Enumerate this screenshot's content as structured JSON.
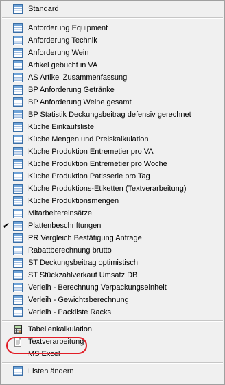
{
  "menu": {
    "top": [
      {
        "label": "Standard",
        "icon": "table-icon",
        "checked": false
      }
    ],
    "lists": [
      {
        "label": "Anforderung Equipment",
        "icon": "table-icon",
        "checked": false
      },
      {
        "label": "Anforderung Technik",
        "icon": "table-icon",
        "checked": false
      },
      {
        "label": "Anforderung Wein",
        "icon": "table-icon",
        "checked": false
      },
      {
        "label": "Artikel gebucht in VA",
        "icon": "table-icon",
        "checked": false
      },
      {
        "label": "AS Artikel Zusammenfassung",
        "icon": "table-icon",
        "checked": false
      },
      {
        "label": "BP Anforderung Getränke",
        "icon": "table-icon",
        "checked": false
      },
      {
        "label": "BP Anforderung Weine gesamt",
        "icon": "table-icon",
        "checked": false
      },
      {
        "label": "BP Statistik Deckungsbeitrag defensiv gerechnet",
        "icon": "table-icon",
        "checked": false
      },
      {
        "label": "Küche Einkaufsliste",
        "icon": "table-icon",
        "checked": false
      },
      {
        "label": "Küche Mengen und Preiskalkulation",
        "icon": "table-icon",
        "checked": false
      },
      {
        "label": "Küche Produktion Entremetier pro VA",
        "icon": "table-icon",
        "checked": false
      },
      {
        "label": "Küche Produktion Entremetier pro Woche",
        "icon": "table-icon",
        "checked": false
      },
      {
        "label": "Küche Produktion Patisserie pro Tag",
        "icon": "table-icon",
        "checked": false
      },
      {
        "label": "Küche Produktions-Etiketten (Textverarbeitung)",
        "icon": "table-icon",
        "checked": false
      },
      {
        "label": "Küche Produktionsmengen",
        "icon": "table-icon",
        "checked": false
      },
      {
        "label": "Mitarbeitereinsätze",
        "icon": "table-icon",
        "checked": false
      },
      {
        "label": "Plattenbeschriftungen",
        "icon": "table-icon",
        "checked": true
      },
      {
        "label": "PR Vergleich Bestätigung Anfrage",
        "icon": "table-icon",
        "checked": false
      },
      {
        "label": "Rabattberechnung brutto",
        "icon": "table-icon",
        "checked": false
      },
      {
        "label": "ST Deckungsbeitrag optimistisch",
        "icon": "table-icon",
        "checked": false
      },
      {
        "label": "ST Stückzahlverkauf Umsatz DB",
        "icon": "table-icon",
        "checked": false
      },
      {
        "label": "Verleih - Berechnung Verpackungseinheit",
        "icon": "table-icon",
        "checked": false
      },
      {
        "label": "Verleih - Gewichtsberechnung",
        "icon": "table-icon",
        "checked": false
      },
      {
        "label": "Verleih - Packliste Racks",
        "icon": "table-icon",
        "checked": false
      }
    ],
    "output": [
      {
        "label": "Tabellenkalkulation",
        "icon": "calculator-icon",
        "checked": false
      },
      {
        "label": "Textverarbeitung",
        "icon": "document-icon",
        "checked": false,
        "highlighted": true
      },
      {
        "label": "MS Excel",
        "icon": "blank-icon",
        "checked": false
      }
    ],
    "bottom": [
      {
        "label": "Listen ändern",
        "icon": "table-icon",
        "checked": false
      }
    ],
    "check_glyph": "✔",
    "highlight_color": "#e11d26"
  }
}
